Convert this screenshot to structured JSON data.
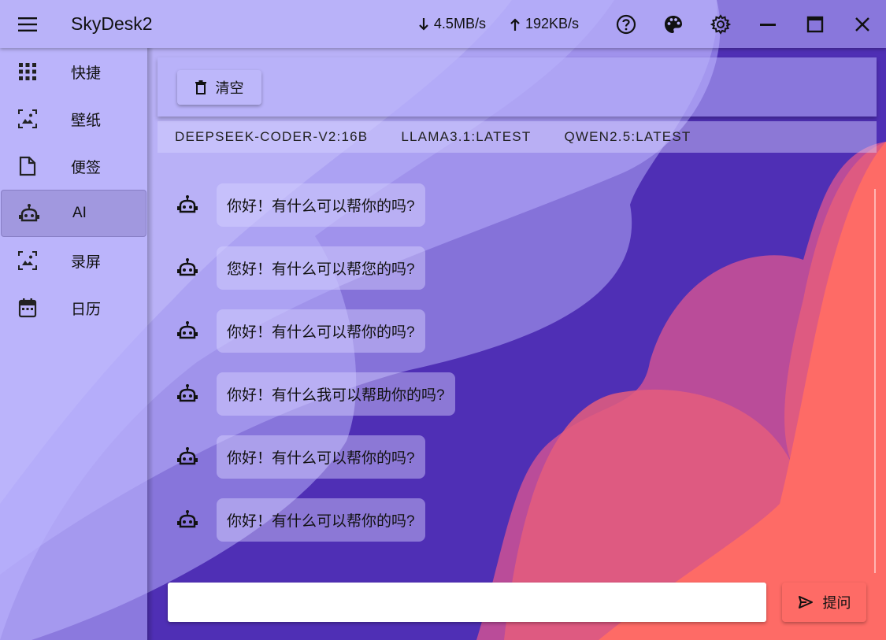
{
  "app": {
    "title": "SkyDesk2"
  },
  "network": {
    "download": "4.5MB/s",
    "upload": "192KB/s"
  },
  "titlebar_icons": [
    "menu-icon",
    "arrow-down-icon",
    "arrow-up-icon",
    "help-icon",
    "palette-icon",
    "gear-icon",
    "minimize-icon",
    "maximize-icon",
    "close-icon"
  ],
  "sidebar": {
    "items": [
      {
        "label": "快捷",
        "icon": "apps-grid-icon"
      },
      {
        "label": "壁纸",
        "icon": "wallpaper-icon"
      },
      {
        "label": "便签",
        "icon": "note-icon"
      },
      {
        "label": "AI",
        "icon": "robot-icon",
        "active": true
      },
      {
        "label": "录屏",
        "icon": "screen-record-icon"
      },
      {
        "label": "日历",
        "icon": "calendar-icon"
      }
    ]
  },
  "toolbar": {
    "clear_label": "清空"
  },
  "models": {
    "tabs": [
      "DEEPSEEK-CODER-V2:16B",
      "LLAMA3.1:LATEST",
      "QWEN2.5:LATEST"
    ]
  },
  "messages": [
    {
      "text": "你好！有什么可以帮你的吗?"
    },
    {
      "text": "您好！有什么可以帮您的吗?"
    },
    {
      "text": "你好！有什么可以帮你的吗?"
    },
    {
      "text": "你好！有什么我可以帮助你的吗?"
    },
    {
      "text": "你好！有什么可以帮你的吗?"
    },
    {
      "text": "你好！有什么可以帮你的吗?"
    }
  ],
  "composer": {
    "value": "",
    "ask_label": "提问"
  },
  "colors": {
    "accent": "#fe6b66",
    "background": "#4f2fb5",
    "panel": "#b9b2fc"
  }
}
